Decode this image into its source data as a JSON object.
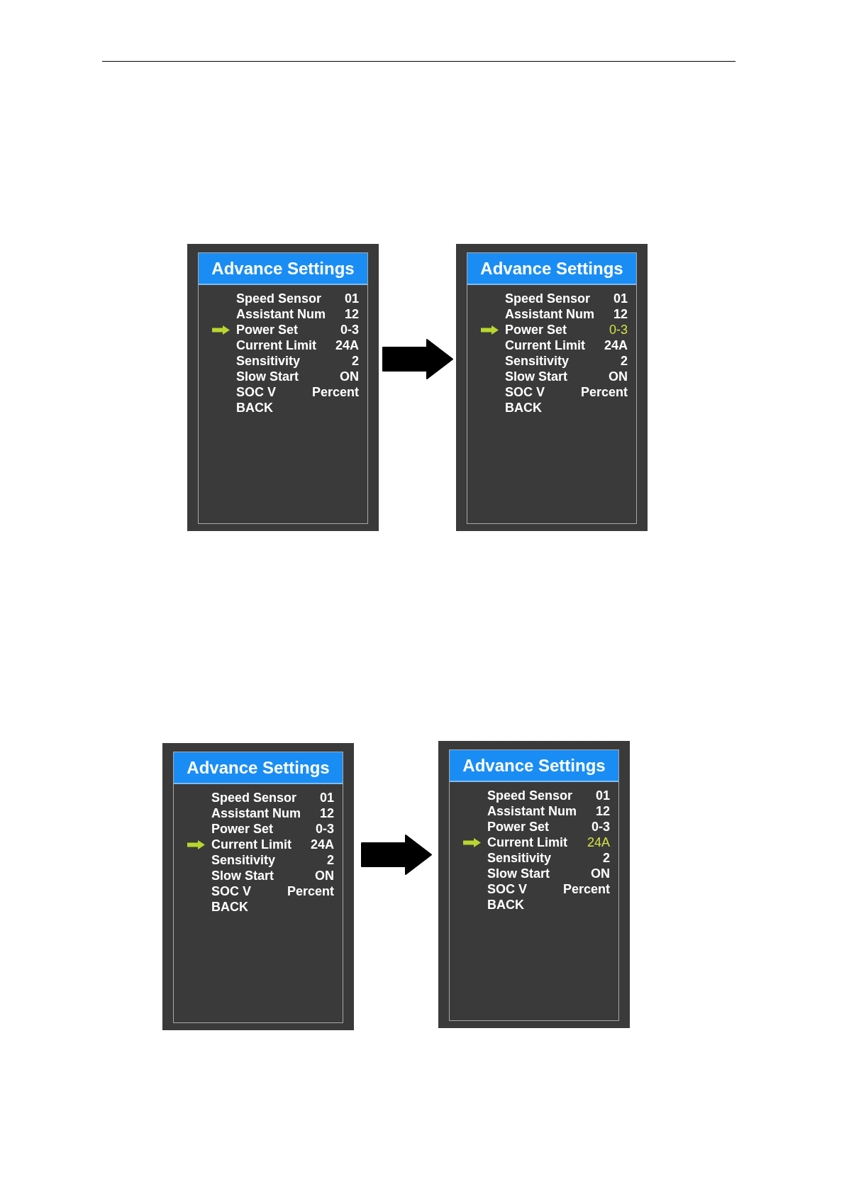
{
  "figures": [
    {
      "screens": [
        {
          "title": "Advance Settings",
          "editing": false,
          "items": [
            {
              "label": "Speed Sensor",
              "value": "01",
              "selected": false
            },
            {
              "label": "Assistant Num",
              "value": "12",
              "selected": false
            },
            {
              "label": "Power Set",
              "value": "0-3",
              "selected": true
            },
            {
              "label": "Current Limit",
              "value": "24A",
              "selected": false
            },
            {
              "label": "Sensitivity",
              "value": "2",
              "selected": false
            },
            {
              "label": "Slow Start",
              "value": "ON",
              "selected": false
            },
            {
              "label": "SOC V",
              "value": "Percent",
              "selected": false
            },
            {
              "label": "BACK",
              "selected": false
            }
          ]
        },
        {
          "title": "Advance Settings",
          "editing": true,
          "items": [
            {
              "label": "Speed Sensor",
              "value": "01",
              "selected": false
            },
            {
              "label": "Assistant Num",
              "value": "12",
              "selected": false
            },
            {
              "label": "Power Set",
              "value": "0-3",
              "selected": true
            },
            {
              "label": "Current Limit",
              "value": "24A",
              "selected": false
            },
            {
              "label": "Sensitivity",
              "value": "2",
              "selected": false
            },
            {
              "label": "Slow Start",
              "value": "ON",
              "selected": false
            },
            {
              "label": "SOC V",
              "value": "Percent",
              "selected": false
            },
            {
              "label": "BACK",
              "selected": false
            }
          ]
        }
      ]
    },
    {
      "screens": [
        {
          "title": "Advance Settings",
          "editing": false,
          "items": [
            {
              "label": "Speed Sensor",
              "value": "01",
              "selected": false
            },
            {
              "label": "Assistant Num",
              "value": "12",
              "selected": false
            },
            {
              "label": "Power Set",
              "value": "0-3",
              "selected": false
            },
            {
              "label": "Current Limit",
              "value": "24A",
              "selected": true
            },
            {
              "label": "Sensitivity",
              "value": "2",
              "selected": false
            },
            {
              "label": "Slow Start",
              "value": "ON",
              "selected": false
            },
            {
              "label": "SOC V",
              "value": "Percent",
              "selected": false
            },
            {
              "label": "BACK",
              "selected": false
            }
          ]
        },
        {
          "title": "Advance Settings",
          "editing": true,
          "items": [
            {
              "label": "Speed Sensor",
              "value": "01",
              "selected": false
            },
            {
              "label": "Assistant Num",
              "value": "12",
              "selected": false
            },
            {
              "label": "Power Set",
              "value": "0-3",
              "selected": false
            },
            {
              "label": "Current Limit",
              "value": "24A",
              "selected": true
            },
            {
              "label": "Sensitivity",
              "value": "2",
              "selected": false
            },
            {
              "label": "Slow Start",
              "value": "ON",
              "selected": false
            },
            {
              "label": "SOC V",
              "value": "Percent",
              "selected": false
            },
            {
              "label": "BACK",
              "selected": false
            }
          ]
        }
      ]
    }
  ]
}
